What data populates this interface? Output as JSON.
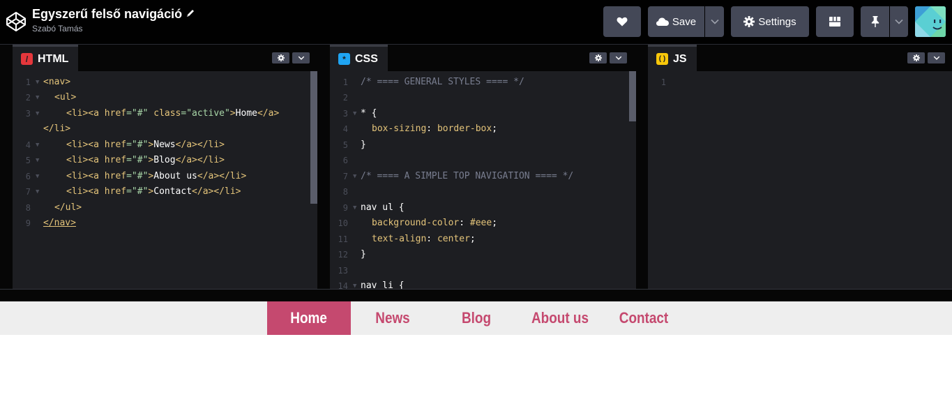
{
  "header": {
    "title": "Egyszerű felső navigáció",
    "author": "Szabó Tamás",
    "save_label": "Save",
    "settings_label": "Settings"
  },
  "panels": {
    "html": {
      "label": "HTML",
      "badge": "/",
      "badge_color": "#e5373c"
    },
    "css": {
      "label": "CSS",
      "badge": "*",
      "badge_color": "#1fa4f2"
    },
    "js": {
      "label": "JS",
      "badge": "( )",
      "badge_color": "#f8c70a"
    }
  },
  "html_code": {
    "line_numbers": [
      "1",
      "2",
      "3",
      "",
      "4",
      "5",
      "6",
      "7",
      "8",
      "9"
    ],
    "l1": "<nav>",
    "l2": "<ul>",
    "l3a": "<li><a",
    "l3b": "href",
    "l3c": "=\"#\"",
    "l3d": "class",
    "l3e": "=\"active\"",
    "l3f": ">",
    "l3g": "Home",
    "l3h": "</a>",
    "l3i": "</li>",
    "l4a": "<li><a",
    "l4b": "href",
    "l4c": "=\"#\"",
    "l4d": ">",
    "l4e": "News",
    "l4f": "</a></li>",
    "l5e": "Blog",
    "l6e": "About us",
    "l7e": "Contact",
    "l8": "</ul>",
    "l9": "</nav>"
  },
  "css_code": {
    "line_numbers": [
      "1",
      "2",
      "3",
      "4",
      "5",
      "6",
      "7",
      "8",
      "9",
      "10",
      "11",
      "12",
      "13",
      "14"
    ],
    "l1": "/* ==== GENERAL STYLES ==== */",
    "l3": "* {",
    "l4a": "box-sizing",
    "l4b": ":",
    "l4c": "border-box",
    "l4d": ";",
    "l5": "}",
    "l7": "/* ==== A SIMPLE TOP NAVIGATION ==== */",
    "l9": "nav ul {",
    "l10a": "background-color",
    "l10c": "#eee",
    "l11a": "text-align",
    "l11c": "center",
    "l12": "}",
    "l14": "nav li {"
  },
  "js_code": {
    "line_numbers": [
      "1"
    ]
  },
  "preview": {
    "links": [
      "Home",
      "News",
      "Blog",
      "About us",
      "Contact"
    ],
    "accent": "#c5496f",
    "nav_bg": "#eeeeee"
  }
}
